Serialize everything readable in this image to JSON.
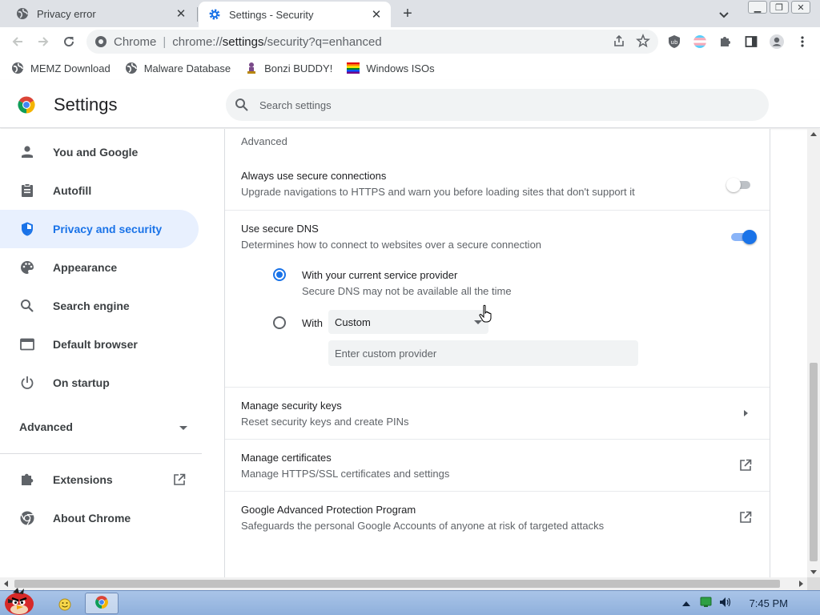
{
  "tabs": [
    {
      "title": "Privacy error",
      "icon": "globe-icon",
      "active": false
    },
    {
      "title": "Settings - Security",
      "icon": "gear-icon",
      "active": true
    }
  ],
  "omnibox": {
    "prefix": "Chrome",
    "url_host": "chrome://",
    "url_bold": "settings",
    "url_path": "/security?q=enhanced"
  },
  "bookmarks": [
    {
      "label": "MEMZ Download",
      "icon": "globe-icon"
    },
    {
      "label": "Malware Database",
      "icon": "globe-icon"
    },
    {
      "label": "Bonzi BUDDY!",
      "icon": "bonzi-icon"
    },
    {
      "label": "Windows ISOs",
      "icon": "rainbow-flag-icon"
    }
  ],
  "header": {
    "title": "Settings",
    "search_placeholder": "Search settings"
  },
  "sidebar": {
    "items": [
      {
        "label": "You and Google",
        "icon": "person-icon",
        "active": false
      },
      {
        "label": "Autofill",
        "icon": "clipboard-icon",
        "active": false
      },
      {
        "label": "Privacy and security",
        "icon": "shield-icon",
        "active": true
      },
      {
        "label": "Appearance",
        "icon": "palette-icon",
        "active": false
      },
      {
        "label": "Search engine",
        "icon": "search-icon",
        "active": false
      },
      {
        "label": "Default browser",
        "icon": "browser-icon",
        "active": false
      },
      {
        "label": "On startup",
        "icon": "power-icon",
        "active": false
      }
    ],
    "advanced_label": "Advanced",
    "extensions_label": "Extensions",
    "about_label": "About Chrome"
  },
  "main": {
    "section_label": "Advanced",
    "secure_connections": {
      "title": "Always use secure connections",
      "subtitle": "Upgrade navigations to HTTPS and warn you before loading sites that don't support it",
      "enabled": false
    },
    "secure_dns": {
      "title": "Use secure DNS",
      "subtitle": "Determines how to connect to websites over a secure connection",
      "enabled": true,
      "option_current_title": "With your current service provider",
      "option_current_subtitle": "Secure DNS may not be available all the time",
      "option_with_label": "With",
      "select_value": "Custom",
      "custom_placeholder": "Enter custom provider"
    },
    "security_keys": {
      "title": "Manage security keys",
      "subtitle": "Reset security keys and create PINs"
    },
    "certificates": {
      "title": "Manage certificates",
      "subtitle": "Manage HTTPS/SSL certificates and settings"
    },
    "advanced_protection": {
      "title": "Google Advanced Protection Program",
      "subtitle": "Safeguards the personal Google Accounts of anyone at risk of targeted attacks"
    }
  },
  "taskbar": {
    "clock": "7:45 PM"
  },
  "colors": {
    "accent": "#1a73e8",
    "active_nav_bg": "#e8f0fe",
    "tabstrip_bg": "#dee1e6"
  }
}
